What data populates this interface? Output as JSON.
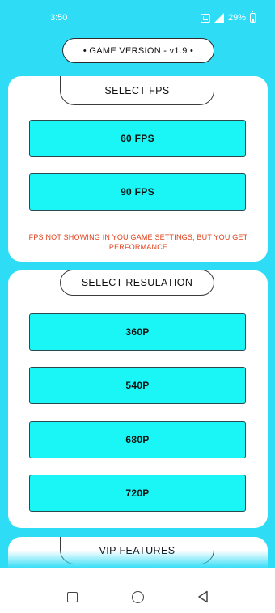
{
  "status_bar": {
    "time": "3:50",
    "battery": "29%",
    "icons": [
      "nfc-icon",
      "signal-icon",
      "battery-icon"
    ]
  },
  "version_pill": "• GAME VERSION - v1.9 •",
  "fps_section": {
    "title": "SELECT FPS",
    "options": [
      "60 FPS",
      "90 FPS"
    ],
    "note": "FPS NOT SHOWING IN YOU GAME SETTINGS, BUT YOU GET PERFORMANCE"
  },
  "resolution_section": {
    "title": "SELECT RESULATION",
    "options": [
      "360P",
      "540P",
      "680P",
      "720P"
    ]
  },
  "vip_section": {
    "title": "VIP FEATURES"
  },
  "nav_bar": {
    "icons": [
      "recents-square-icon",
      "home-circle-icon",
      "back-triangle-icon"
    ]
  },
  "colors": {
    "background": "#2fdcf6",
    "button": "#19f6f5",
    "note": "#e2401a",
    "card": "#ffffff"
  }
}
